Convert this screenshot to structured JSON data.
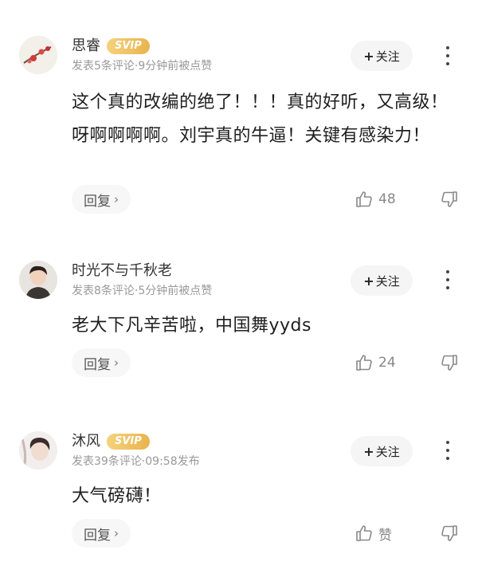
{
  "follow_label": "关注",
  "comments": [
    {
      "user": "思睿",
      "badge": "SVIP",
      "meta": "发表5条评论·9分钟前被点赞",
      "text": "这个真的改编的绝了！！！真的好听，又高级！呀啊啊啊啊。刘宇真的牛逼！关键有感染力！",
      "reply_label": "回复",
      "likes": "48"
    },
    {
      "user": "时光不与千秋老",
      "badge": "",
      "meta": "发表8条评论·5分钟前被点赞",
      "text": "老大下凡辛苦啦，中国舞yyds",
      "reply_label": "回复",
      "likes": "24"
    },
    {
      "user": "沐风",
      "badge": "SVIP",
      "meta": "发表39条评论·09:58发布",
      "text": "大气磅礴！",
      "reply_label": "回复",
      "likes": "赞"
    }
  ]
}
